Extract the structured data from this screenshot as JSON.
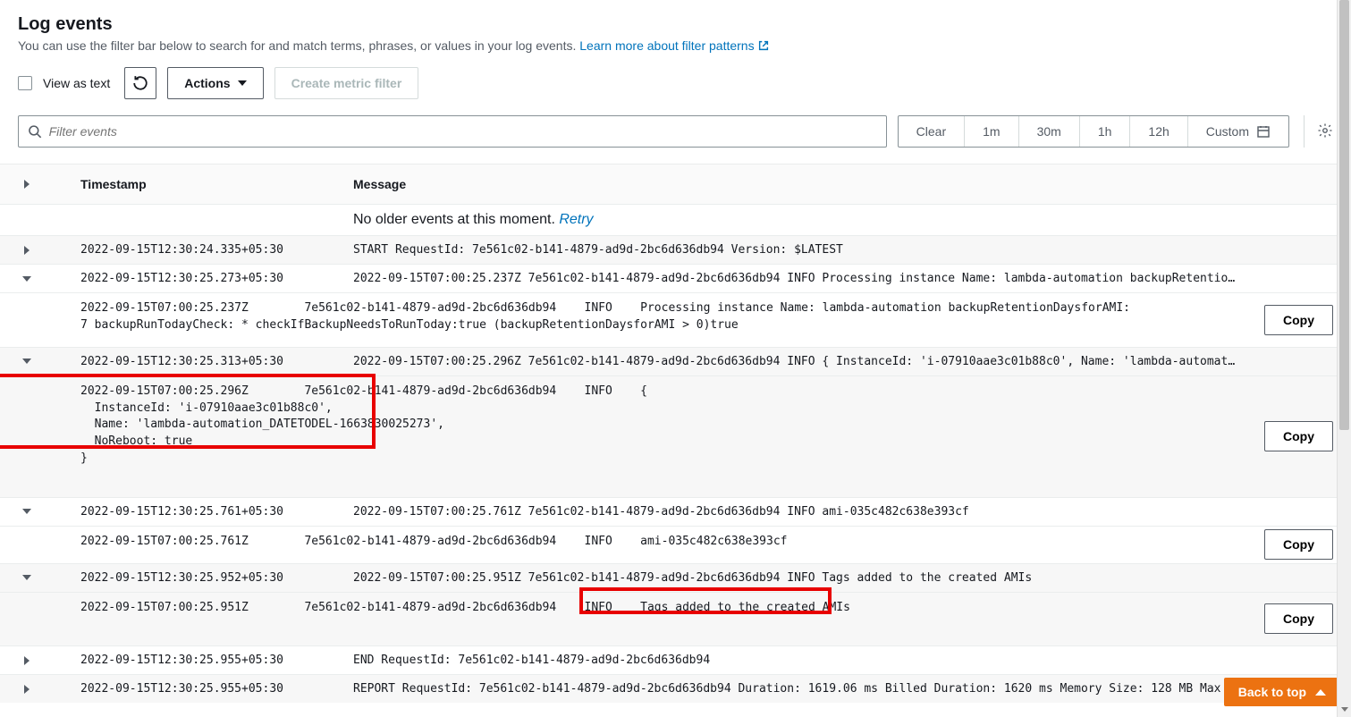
{
  "header": {
    "title": "Log events",
    "subtitle_prefix": "You can use the filter bar below to search for and match terms, phrases, or values in your log events. ",
    "learn_link": "Learn more about filter patterns"
  },
  "toolbar": {
    "view_as_text": "View as text",
    "actions": "Actions",
    "create_metric": "Create metric filter"
  },
  "filter": {
    "placeholder": "Filter events",
    "clear": "Clear",
    "r1m": "1m",
    "r30m": "30m",
    "r1h": "1h",
    "r12h": "12h",
    "custom": "Custom"
  },
  "columns": {
    "timestamp": "Timestamp",
    "message": "Message"
  },
  "no_older": {
    "text": "No older events at this moment. ",
    "retry": "Retry"
  },
  "copy_label": "Copy",
  "rows": {
    "r1": {
      "ts": "2022-09-15T12:30:24.335+05:30",
      "msg": "START RequestId: 7e561c02-b141-4879-ad9d-2bc6d636db94 Version: $LATEST"
    },
    "r2": {
      "ts": "2022-09-15T12:30:25.273+05:30",
      "msg": "2022-09-15T07:00:25.237Z 7e561c02-b141-4879-ad9d-2bc6d636db94 INFO Processing instance Name: lambda-automation backupRetentio…",
      "exp": "2022-09-15T07:00:25.237Z        7e561c02-b141-4879-ad9d-2bc6d636db94    INFO    Processing instance Name: lambda-automation backupRetentionDaysforAMI:\n7 backupRunTodayCheck: * checkIfBackupNeedsToRunToday:true (backupRetentionDaysforAMI > 0)true"
    },
    "r3": {
      "ts": "2022-09-15T12:30:25.313+05:30",
      "msg": "2022-09-15T07:00:25.296Z 7e561c02-b141-4879-ad9d-2bc6d636db94 INFO { InstanceId: 'i-07910aae3c01b88c0', Name: 'lambda-automat…",
      "exp": "2022-09-15T07:00:25.296Z        7e561c02-b141-4879-ad9d-2bc6d636db94    INFO    {\n  InstanceId: 'i-07910aae3c01b88c0',\n  Name: 'lambda-automation_DATETODEL-1663830025273',\n  NoReboot: true\n}"
    },
    "r4": {
      "ts": "2022-09-15T12:30:25.761+05:30",
      "msg": "2022-09-15T07:00:25.761Z 7e561c02-b141-4879-ad9d-2bc6d636db94 INFO ami-035c482c638e393cf",
      "exp": "2022-09-15T07:00:25.761Z        7e561c02-b141-4879-ad9d-2bc6d636db94    INFO    ami-035c482c638e393cf"
    },
    "r5": {
      "ts": "2022-09-15T12:30:25.952+05:30",
      "msg": "2022-09-15T07:00:25.951Z 7e561c02-b141-4879-ad9d-2bc6d636db94 INFO Tags added to the created AMIs",
      "exp": "2022-09-15T07:00:25.951Z        7e561c02-b141-4879-ad9d-2bc6d636db94    INFO    Tags added to the created AMIs"
    },
    "r6": {
      "ts": "2022-09-15T12:30:25.955+05:30",
      "msg": "END RequestId: 7e561c02-b141-4879-ad9d-2bc6d636db94"
    },
    "r7": {
      "ts": "2022-09-15T12:30:25.955+05:30",
      "msg": "REPORT RequestId: 7e561c02-b141-4879-ad9d-2bc6d636db94 Duration: 1619.06 ms Billed Duration: 1620 ms Memory Size: 128 MB Max …"
    }
  },
  "back_top": "Back to top"
}
